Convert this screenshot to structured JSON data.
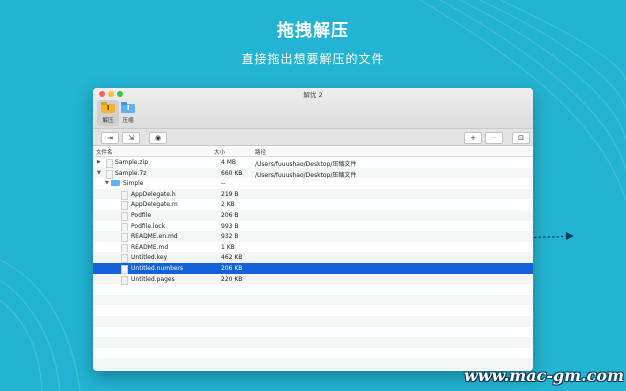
{
  "hero": {
    "title": "拖拽解压",
    "subtitle": "直接拖出想要解压的文件"
  },
  "window": {
    "title": "解优 2",
    "tabs": [
      {
        "label": "解压",
        "active": true
      },
      {
        "label": "压缩",
        "active": false
      }
    ]
  },
  "columns": {
    "name": "文件名",
    "size": "大小",
    "path": "路径"
  },
  "rows": [
    {
      "name": "Sample.zip",
      "size": "4 MB",
      "path": "/Users/fuuushao/Desktop/压缩文件",
      "level": 0,
      "expand": "▶",
      "icon": "zip-icon"
    },
    {
      "name": "Sample.7z",
      "size": "660 KB",
      "path": "/Users/fuuushao/Desktop/压缩文件",
      "level": 0,
      "expand": "▼",
      "icon": "archive-icon"
    },
    {
      "name": "Simple",
      "size": "--",
      "path": "",
      "level": 1,
      "expand": "▼",
      "icon": "folder-icon"
    },
    {
      "name": "AppDelegate.h",
      "size": "219 B",
      "path": "",
      "level": 2,
      "expand": "",
      "icon": "h-file-icon"
    },
    {
      "name": "AppDelegate.m",
      "size": "2 KB",
      "path": "",
      "level": 2,
      "expand": "",
      "icon": "m-file-icon"
    },
    {
      "name": "Podfile",
      "size": "206 B",
      "path": "",
      "level": 2,
      "expand": "",
      "icon": "file-icon"
    },
    {
      "name": "Podfile.lock",
      "size": "993 B",
      "path": "",
      "level": 2,
      "expand": "",
      "icon": "file-icon"
    },
    {
      "name": "README.en.md",
      "size": "932 B",
      "path": "",
      "level": 2,
      "expand": "",
      "icon": "md-file-icon"
    },
    {
      "name": "README.md",
      "size": "1 KB",
      "path": "",
      "level": 2,
      "expand": "",
      "icon": "md-file-icon"
    },
    {
      "name": "Untitled.key",
      "size": "462 KB",
      "path": "",
      "level": 2,
      "expand": "",
      "icon": "keynote-icon"
    },
    {
      "name": "Untitled.numbers",
      "size": "206 KB",
      "path": "",
      "level": 2,
      "expand": "",
      "icon": "numbers-icon",
      "selected": true
    },
    {
      "name": "Untitled.pages",
      "size": "220 KB",
      "path": "",
      "level": 2,
      "expand": "",
      "icon": "pages-icon"
    }
  ],
  "watermark": "www.mac-gm.com",
  "colors": {
    "background": "#22b4d2",
    "selection": "#1462d8"
  }
}
